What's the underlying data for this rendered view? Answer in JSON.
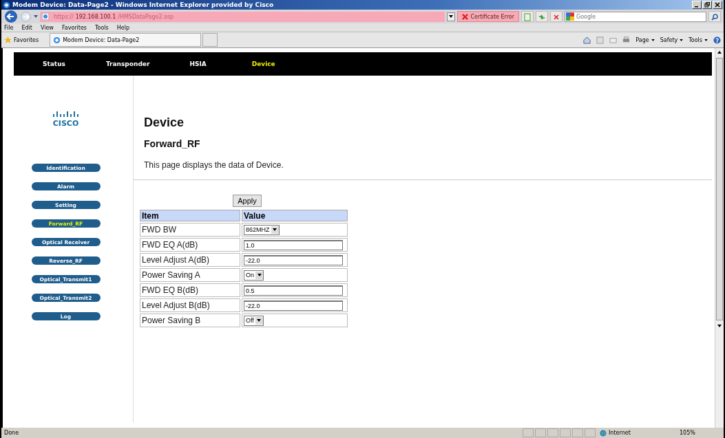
{
  "window": {
    "title": "Modem Device: Data-Page2 - Windows Internet Explorer provided by Cisco"
  },
  "address_bar": {
    "scheme": "https://",
    "host": "192.168.100.1",
    "path": "/HMSDataPage2.asp",
    "certificate": "Certificate Error",
    "search_placeholder": "Google"
  },
  "menu": [
    "File",
    "Edit",
    "View",
    "Favorites",
    "Tools",
    "Help"
  ],
  "favorites_bar": {
    "label": "Favorites",
    "tab": "Modem Device: Data-Page2",
    "commands": [
      "Page",
      "Safety",
      "Tools"
    ]
  },
  "nav_tabs": [
    {
      "label": "Status",
      "selected": false
    },
    {
      "label": "Transponder",
      "selected": false
    },
    {
      "label": "HSIA",
      "selected": false
    },
    {
      "label": "Device",
      "selected": true
    }
  ],
  "sidebar": {
    "logo_text": "CISCO",
    "items": [
      {
        "label": "Identification",
        "selected": false
      },
      {
        "label": "Alarm",
        "selected": false
      },
      {
        "label": "Setting",
        "selected": false
      },
      {
        "label": "Forward_RF",
        "selected": true
      },
      {
        "label": "Optical Receiver",
        "selected": false
      },
      {
        "label": "Reverse_RF",
        "selected": false
      },
      {
        "label": "Optical_Transmit1",
        "selected": false
      },
      {
        "label": "Optical_Transmit2",
        "selected": false
      },
      {
        "label": "Log",
        "selected": false
      }
    ]
  },
  "page": {
    "title": "Device",
    "subtitle": "Forward_RF",
    "description": "This page displays the data of Device.",
    "apply": "Apply"
  },
  "table": {
    "columns": [
      "Item",
      "Value"
    ],
    "rows": [
      {
        "item": "FWD BW",
        "kind": "select",
        "value": "862MHZ"
      },
      {
        "item": "FWD EQ A(dB)",
        "kind": "input",
        "value": "1.0"
      },
      {
        "item": "Level Adjust A(dB)",
        "kind": "input",
        "value": "-22.0"
      },
      {
        "item": "Power Saving A",
        "kind": "select",
        "value": "On"
      },
      {
        "item": "FWD EQ B(dB)",
        "kind": "input",
        "value": "0.5"
      },
      {
        "item": "Level Adjust B(dB)",
        "kind": "input",
        "value": "-22.0"
      },
      {
        "item": "Power Saving B",
        "kind": "select",
        "value": "Off"
      }
    ]
  },
  "status_bar": {
    "status": "Done",
    "zone": "Internet",
    "zoom": "105%"
  }
}
